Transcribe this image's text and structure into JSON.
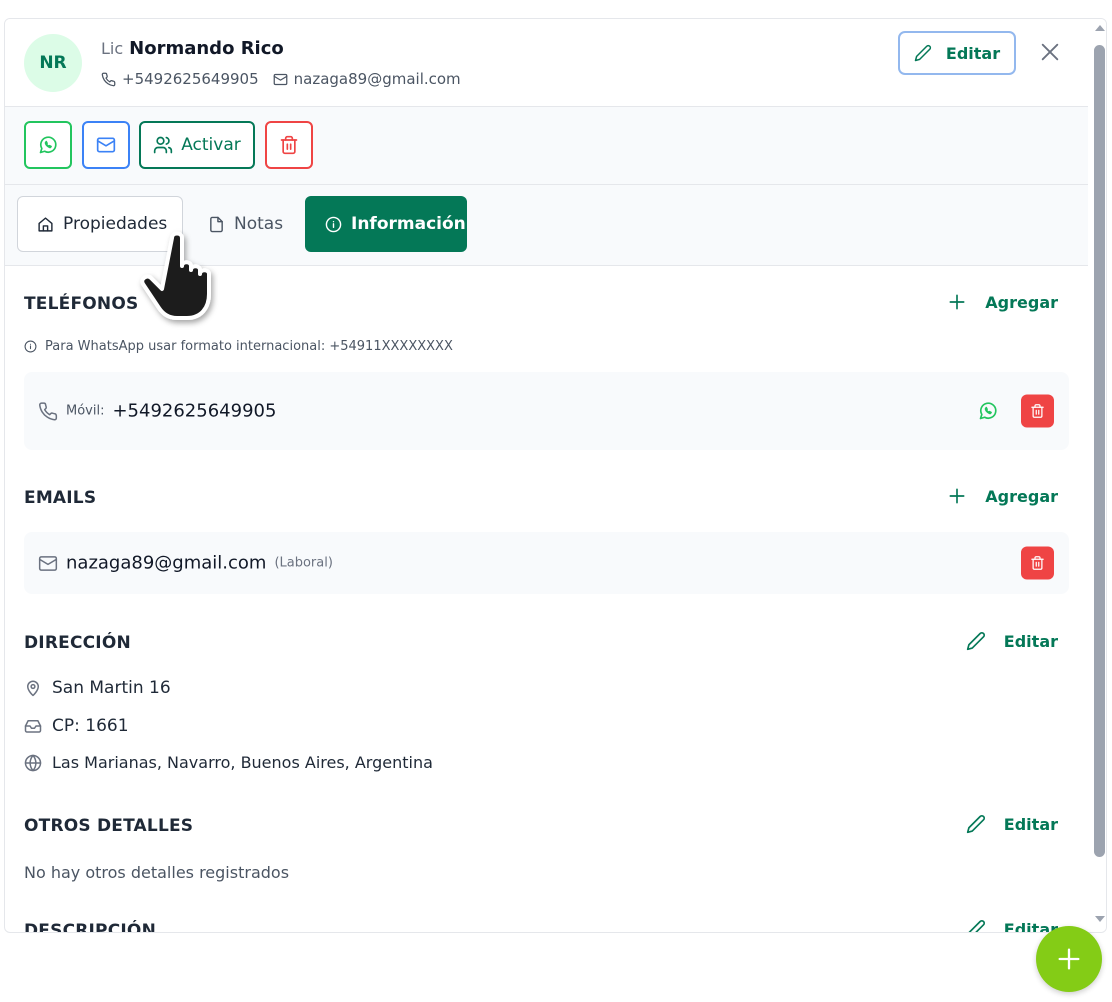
{
  "header": {
    "avatar_initials": "NR",
    "prefix": "Lic",
    "name": "Normando Rico",
    "phone": "+5492625649905",
    "email": "nazaga89@gmail.com",
    "edit_label": "Editar",
    "close_icon": "close-icon"
  },
  "actions": {
    "whatsapp_icon": "whatsapp-icon",
    "mail_icon": "mail-icon",
    "activate_label": "Activar",
    "delete_icon": "trash-icon"
  },
  "tabs": [
    {
      "label": "Propiedades",
      "icon": "home-icon",
      "active": false
    },
    {
      "label": "Notas",
      "icon": "document-icon",
      "active": false
    },
    {
      "label": "Información",
      "icon": "info-icon",
      "active": true
    }
  ],
  "phones": {
    "title": "TELÉFONOS",
    "add_label": "Agregar",
    "hint": "Para WhatsApp usar formato internacional: +54911XXXXXXXX",
    "items": [
      {
        "type_label": "Móvil:",
        "number": "+5492625649905"
      }
    ]
  },
  "emails": {
    "title": "EMAILS",
    "add_label": "Agregar",
    "items": [
      {
        "address": "nazaga89@gmail.com",
        "type": "(Laboral)"
      }
    ]
  },
  "address": {
    "title": "DIRECCIÓN",
    "edit_label": "Editar",
    "street": "San Martin 16",
    "postal_code": "CP: 1661",
    "location": "Las Marianas, Navarro, Buenos Aires, Argentina"
  },
  "other_details": {
    "title": "OTROS DETALLES",
    "edit_label": "Editar",
    "empty_text": "No hay otros detalles registrados"
  },
  "description": {
    "title": "DESCRIPCIÓN",
    "edit_label": "Editar"
  },
  "colors": {
    "brand_green": "#047857",
    "whatsapp_green": "#22c55e",
    "mail_blue": "#3b82f6",
    "danger_red": "#ef4444",
    "fab_lime": "#84cc16"
  }
}
